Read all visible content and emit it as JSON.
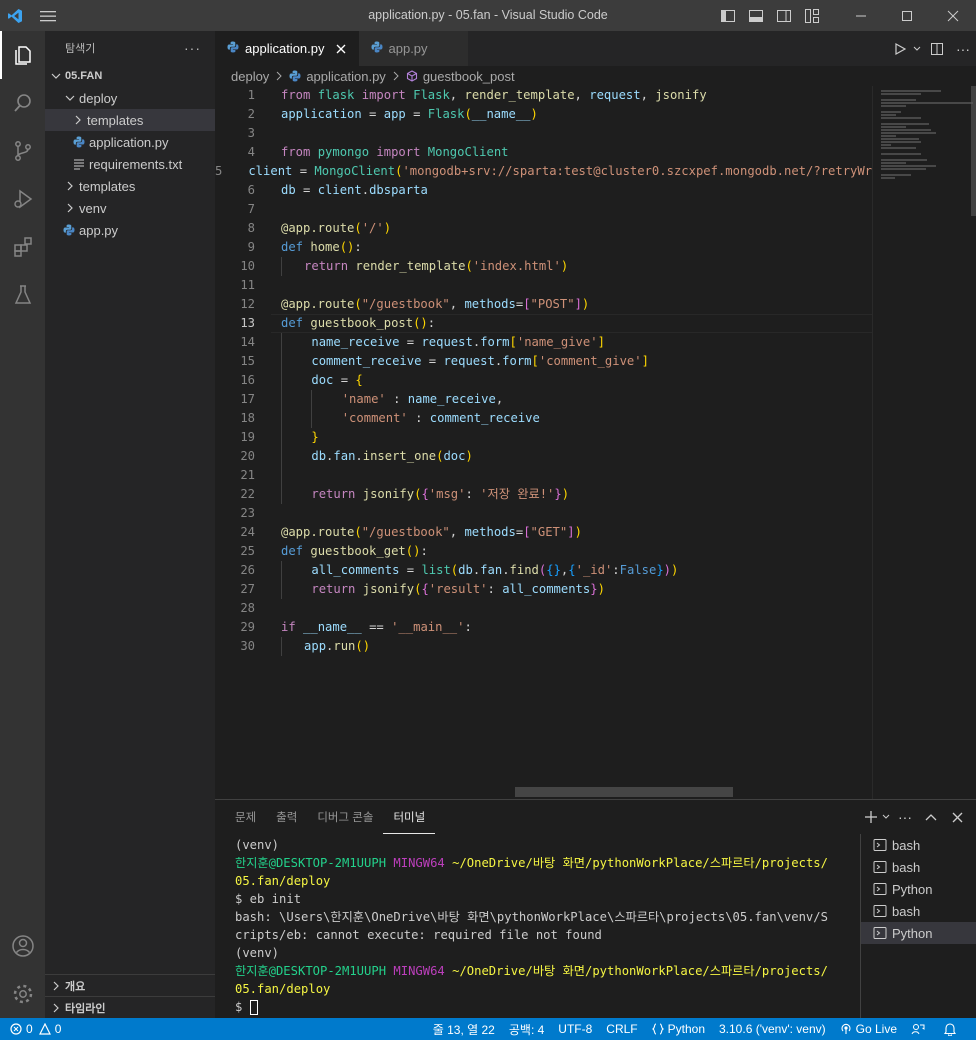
{
  "window": {
    "title": "application.py - 05.fan - Visual Studio Code"
  },
  "sidebar": {
    "title": "탐색기",
    "root": "05.FAN",
    "tree": [
      {
        "label": "deploy",
        "kind": "folder-open",
        "depth": 1
      },
      {
        "label": "templates",
        "kind": "folder-closed",
        "depth": 2
      },
      {
        "label": "application.py",
        "kind": "python",
        "depth": 2
      },
      {
        "label": "requirements.txt",
        "kind": "text",
        "depth": 2
      },
      {
        "label": "templates",
        "kind": "folder-closed",
        "depth": 1
      },
      {
        "label": "venv",
        "kind": "folder-closed",
        "depth": 1
      },
      {
        "label": "app.py",
        "kind": "python",
        "depth": 1
      }
    ],
    "outline": "개요",
    "timeline": "타임라인"
  },
  "editor": {
    "tabs": [
      {
        "label": "application.py",
        "active": true
      },
      {
        "label": "app.py",
        "active": false
      }
    ],
    "breadcrumb": [
      "deploy",
      "application.py",
      "guestbook_post"
    ],
    "current_line": 13
  },
  "panel": {
    "tabs": [
      "문제",
      "출력",
      "디버그 콘솔",
      "터미널"
    ],
    "active_tab": "터미널",
    "terminal_lines": [
      "(venv)",
      "한지훈@DESKTOP-2M1UUPH MINGW64 ~/OneDrive/바탕 화면/pythonWorkPlace/스파르타/projects/",
      "05.fan/deploy",
      "$ eb init",
      "bash: \\Users\\한지훈\\OneDrive\\바탕 화면\\pythonWorkPlace\\스파르타\\projects\\05.fan\\venv/S",
      "cripts/eb: cannot execute: required file not found",
      "(venv)",
      "한지훈@DESKTOP-2M1UUPH MINGW64 ~/OneDrive/바탕 화면/pythonWorkPlace/스파르타/projects/",
      "05.fan/deploy",
      "$ "
    ],
    "terminals": [
      "bash",
      "bash",
      "Python",
      "bash",
      "Python"
    ]
  },
  "statusbar": {
    "errors": "0",
    "warnings": "0",
    "position": "줄 13, 열 22",
    "spaces": "공백: 4",
    "encoding": "UTF-8",
    "eol": "CRLF",
    "language": "Python",
    "interpreter": "3.10.6 ('venv': venv)",
    "golive": "Go Live"
  }
}
